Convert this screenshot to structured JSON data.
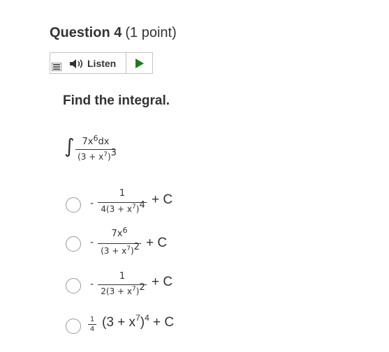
{
  "question": {
    "title": "Question 4",
    "points": "(1 point)",
    "prompt": "Find the integral."
  },
  "listen": {
    "label": "Listen",
    "icons": {
      "menu": "menu-icon",
      "speaker": "speaker-icon",
      "play": "play-icon"
    },
    "accent": "#1f7a1f"
  },
  "integral": {
    "sign": "∫",
    "numerator": "7x",
    "numerator_exp": "6",
    "numerator_tail": "dx",
    "denominator": "(3 + x",
    "denominator_exp_inner": "7",
    "denominator_close": ")",
    "denominator_exp_outer": "3"
  },
  "options": [
    {
      "id": "a",
      "sign": "-",
      "numerator": "1",
      "den_prefix": "4(3 + x",
      "den_inner_exp": "7",
      "den_close": ")",
      "den_outer_exp": "4",
      "suffix": "+ C"
    },
    {
      "id": "b",
      "sign": "-",
      "numerator": "7x",
      "numerator_exp": "6",
      "den_prefix": "(3 + x",
      "den_inner_exp": "7",
      "den_close": ")",
      "den_outer_exp": "2",
      "suffix": "+ C"
    },
    {
      "id": "c",
      "sign": "-",
      "numerator": "1",
      "den_prefix": "2(3 + x",
      "den_inner_exp": "7",
      "den_close": ")",
      "den_outer_exp": "2",
      "suffix": "+ C"
    },
    {
      "id": "d",
      "coef_num": "1",
      "coef_den": "4",
      "body_prefix": "(3 + x",
      "body_inner_exp": "7",
      "body_close": ")",
      "body_outer_exp": "4",
      "suffix": "+ C"
    }
  ]
}
